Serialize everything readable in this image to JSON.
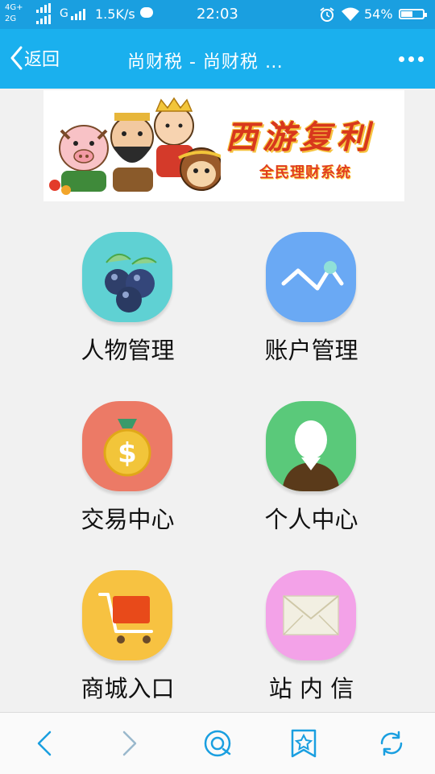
{
  "status_bar": {
    "network_top": "4G+",
    "network_bottom": "2G",
    "second_sim": "G",
    "speed": "1.5K/s",
    "time": "22:03",
    "battery": "54%",
    "battery_level": 0.54
  },
  "nav": {
    "back_label": "返回",
    "title": "尚财税 - 尚财税 …"
  },
  "banner": {
    "title": "西游复利",
    "subtitle": "全民理财系统"
  },
  "menu": [
    {
      "label": "人物管理",
      "icon": "blueberry-icon",
      "color": "#5fd1d3"
    },
    {
      "label": "账户管理",
      "icon": "trend-line-icon",
      "color": "#6aa9f4"
    },
    {
      "label": "交易中心",
      "icon": "money-bag-icon",
      "color": "#ec7a66"
    },
    {
      "label": "个人中心",
      "icon": "person-icon",
      "color": "#5ac97a"
    },
    {
      "label": "商城入口",
      "icon": "shopping-cart-icon",
      "color": "#f7c241"
    },
    {
      "label": "站 内 信",
      "icon": "envelope-icon",
      "color": "#f3a2e8"
    }
  ],
  "toolbar": {
    "accent": "#1a9fe0",
    "icons": [
      "back-arrow-icon",
      "forward-arrow-icon",
      "home-qq-icon",
      "bookmark-star-icon",
      "refresh-icon"
    ]
  }
}
